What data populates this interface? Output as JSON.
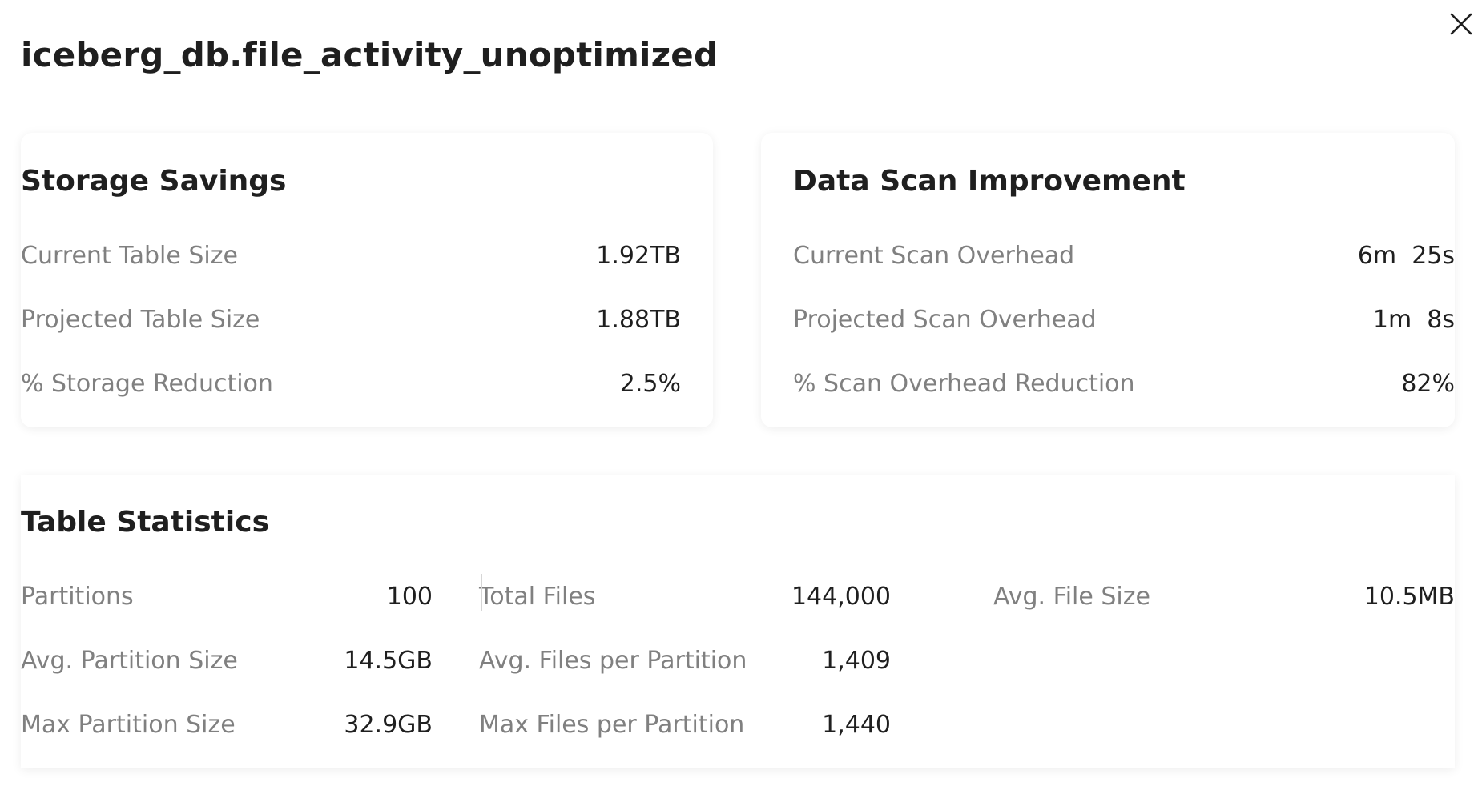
{
  "dialog": {
    "title": "iceberg_db.file_activity_unoptimized"
  },
  "storage_savings": {
    "title": "Storage Savings",
    "rows": [
      {
        "label": "Current Table Size",
        "value": "1.92TB"
      },
      {
        "label": "Projected Table Size",
        "value": "1.88TB"
      },
      {
        "label": "% Storage Reduction",
        "value": "2.5%"
      }
    ]
  },
  "data_scan": {
    "title": "Data Scan Improvement",
    "rows": [
      {
        "label": "Current Scan Overhead",
        "value": "6m  25s"
      },
      {
        "label": "Projected Scan Overhead",
        "value": "1m  8s"
      },
      {
        "label": "% Scan Overhead Reduction",
        "value": "82%"
      }
    ]
  },
  "table_statistics": {
    "title": "Table Statistics",
    "col1": [
      {
        "label": "Partitions",
        "value": "100"
      },
      {
        "label": "Avg. Partition Size",
        "value": "14.5GB"
      },
      {
        "label": "Max Partition Size",
        "value": "32.9GB"
      }
    ],
    "col2": [
      {
        "label": "Total Files",
        "value": "144,000"
      },
      {
        "label": "Avg. Files per Partition",
        "value": "1,409"
      },
      {
        "label": "Max Files per Partition",
        "value": "1,440"
      }
    ],
    "col3": [
      {
        "label": "Avg. File Size",
        "value": "10.5MB"
      }
    ]
  },
  "icons": {
    "close": "close-icon"
  },
  "colors": {
    "label": "#808080",
    "value": "#1f1f1f",
    "divider": "#d6d6d6"
  }
}
